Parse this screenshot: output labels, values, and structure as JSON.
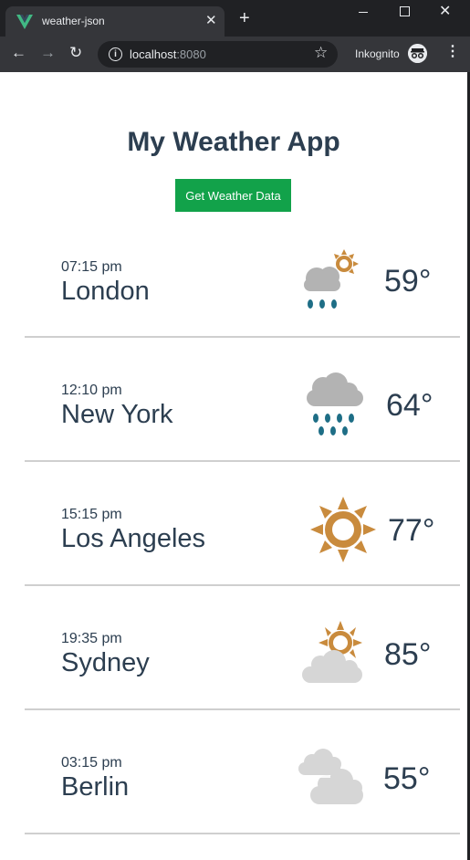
{
  "browser": {
    "tab_title": "weather-json",
    "tab_close": "✕",
    "new_tab": "+",
    "url_host": "localhost",
    "url_port": ":8080",
    "incognito_label": "Inkognito",
    "colors": {
      "chrome_dark": "#202124",
      "chrome_tab": "#35363a",
      "favicon": "#41b883"
    }
  },
  "app": {
    "title": "My Weather App",
    "button_label": "Get Weather Data",
    "accent_color": "#12a24a",
    "text_color": "#2c3e50",
    "cities": [
      {
        "time": "07:15 pm",
        "name": "London",
        "temp": "59°",
        "icon": "partly-sunny-rain-icon"
      },
      {
        "time": "12:10 pm",
        "name": "New York",
        "temp": "64°",
        "icon": "rain-cloud-icon"
      },
      {
        "time": "15:15 pm",
        "name": "Los Angeles",
        "temp": "77°",
        "icon": "sun-icon"
      },
      {
        "time": "19:35 pm",
        "name": "Sydney",
        "temp": "85°",
        "icon": "partly-cloudy-icon"
      },
      {
        "time": "03:15 pm",
        "name": "Berlin",
        "temp": "55°",
        "icon": "cloudy-icon"
      }
    ]
  }
}
